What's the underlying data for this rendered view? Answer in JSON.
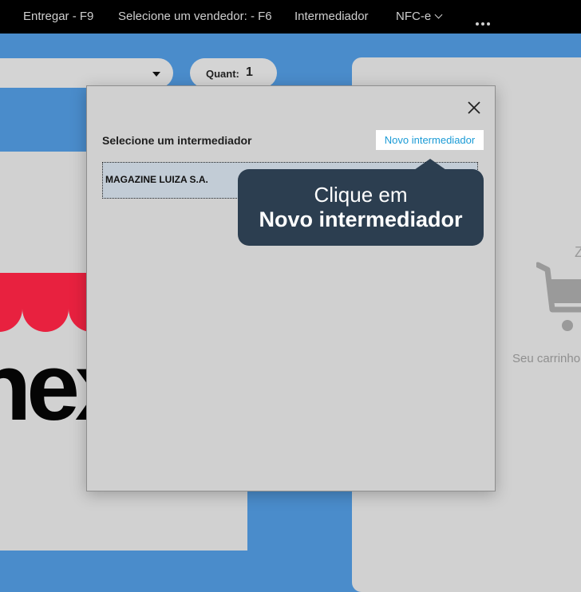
{
  "topbar": {
    "deliver": "Entregar - F9",
    "seller": "Selecione um vendedor: - F6",
    "intermediary": "Intermediador",
    "nfce": "NFC-e"
  },
  "background": {
    "quantity_label": "Quant:",
    "quantity_value": "1",
    "logo_text": "nex",
    "cart_partial_letter": "Z",
    "cart_text": "Seu carrinho"
  },
  "modal": {
    "title": "Selecione um intermediador",
    "new_button": "Novo intermediador",
    "items": [
      {
        "name": "MAGAZINE LUIZA S.A."
      }
    ]
  },
  "tooltip": {
    "line1": "Clique em",
    "line2": "Novo intermediador",
    "background_color": "#2c3e50"
  },
  "colors": {
    "accent_blue": "#4a8ccb",
    "link": "#1b9bd6",
    "brand_red": "#e8213f"
  }
}
